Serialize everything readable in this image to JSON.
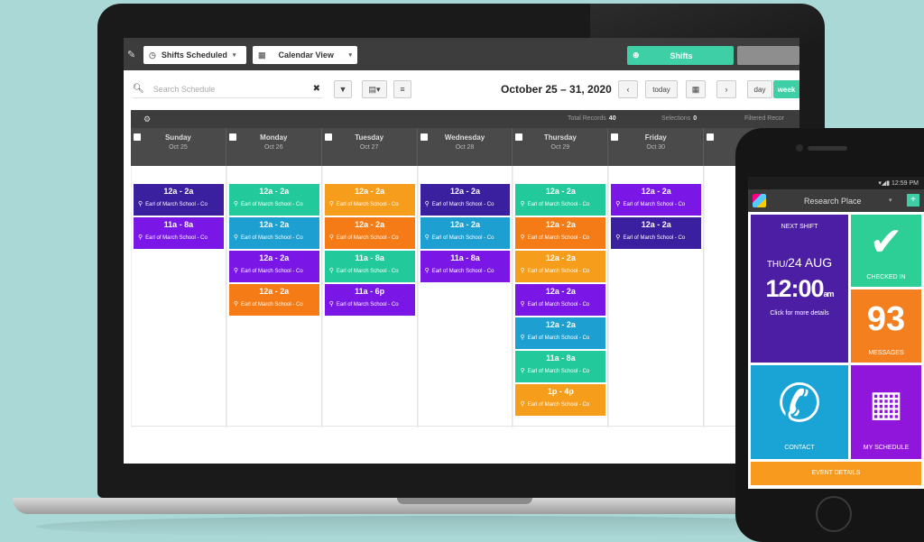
{
  "colors": {
    "background": "#a9d8d6",
    "accent_green": "#3fcfa6",
    "shift_colors": {
      "navy": "#3a1f9e",
      "purple": "#7a16e6",
      "green": "#22c99a",
      "blue": "#1d9fd1",
      "orange": "#f57b16",
      "amber": "#f79d1c"
    }
  },
  "topbar": {
    "shifts_dropdown": "Shifts Scheduled",
    "view_dropdown": "Calendar View",
    "shifts_button": "Shifts"
  },
  "subbar": {
    "search_placeholder": "Search Schedule",
    "date_range": "October 25 – 31, 2020",
    "today_button": "today",
    "day_button": "day",
    "week_button": "week"
  },
  "stats": {
    "total_records_label": "Total Records",
    "total_records": "40",
    "selections_label": "Selections",
    "selections": "0",
    "filtered_label": "Filtered Recor"
  },
  "days": [
    {
      "name": "Sunday",
      "date": "Oct 25"
    },
    {
      "name": "Monday",
      "date": "Oct 26"
    },
    {
      "name": "Tuesday",
      "date": "Oct 27"
    },
    {
      "name": "Wednesday",
      "date": "Oct 28"
    },
    {
      "name": "Thursday",
      "date": "Oct 29"
    },
    {
      "name": "Friday",
      "date": "Oct 30"
    },
    {
      "name": "",
      "date": ""
    }
  ],
  "location_text": "Earl of March School - Co",
  "shifts": [
    [
      {
        "time": "12a - 2a",
        "color": "#3a1f9e"
      },
      {
        "time": "11a - 8a",
        "color": "#7a16e6"
      }
    ],
    [
      {
        "time": "12a - 2a",
        "color": "#22c99a"
      },
      {
        "time": "12a - 2a",
        "color": "#1d9fd1"
      },
      {
        "time": "12a - 2a",
        "color": "#7a16e6"
      },
      {
        "time": "12a - 2a",
        "color": "#f57b16"
      }
    ],
    [
      {
        "time": "12a - 2a",
        "color": "#f79d1c"
      },
      {
        "time": "12a - 2a",
        "color": "#f57b16"
      },
      {
        "time": "11a - 8a",
        "color": "#22c99a"
      },
      {
        "time": "11a - 6p",
        "color": "#7a16e6"
      }
    ],
    [
      {
        "time": "12a - 2a",
        "color": "#3a1f9e"
      },
      {
        "time": "12a - 2a",
        "color": "#1d9fd1"
      },
      {
        "time": "11a - 8a",
        "color": "#7a16e6"
      }
    ],
    [
      {
        "time": "12a - 2a",
        "color": "#22c99a"
      },
      {
        "time": "12a - 2a",
        "color": "#f57b16"
      },
      {
        "time": "12a - 2a",
        "color": "#f79d1c"
      },
      {
        "time": "12a - 2a",
        "color": "#7a16e6"
      },
      {
        "time": "12a - 2a",
        "color": "#1d9fd1"
      },
      {
        "time": "11a - 8a",
        "color": "#22c99a"
      },
      {
        "time": "1p - 4p",
        "color": "#f79d1c"
      }
    ],
    [
      {
        "time": "12a - 2a",
        "color": "#7a16e6"
      },
      {
        "time": "12a - 2a",
        "color": "#3a1f9e"
      }
    ],
    []
  ],
  "phone": {
    "status_time": "12:59 PM",
    "app_title": "Research Place",
    "next_shift_label": "NEXT SHIFT",
    "next_shift_day": "THU",
    "next_shift_date": "24 AUG",
    "next_shift_time": "12:00",
    "next_shift_ampm": "am",
    "next_shift_hint": "Click for more details",
    "checked_in_label": "CHECKED IN",
    "messages_count": "93",
    "messages_label": "MESSAGES",
    "contact_label": "CONTACT",
    "schedule_label": "MY SCHEDULE",
    "event_details_label": "EVENT DETAILS"
  }
}
